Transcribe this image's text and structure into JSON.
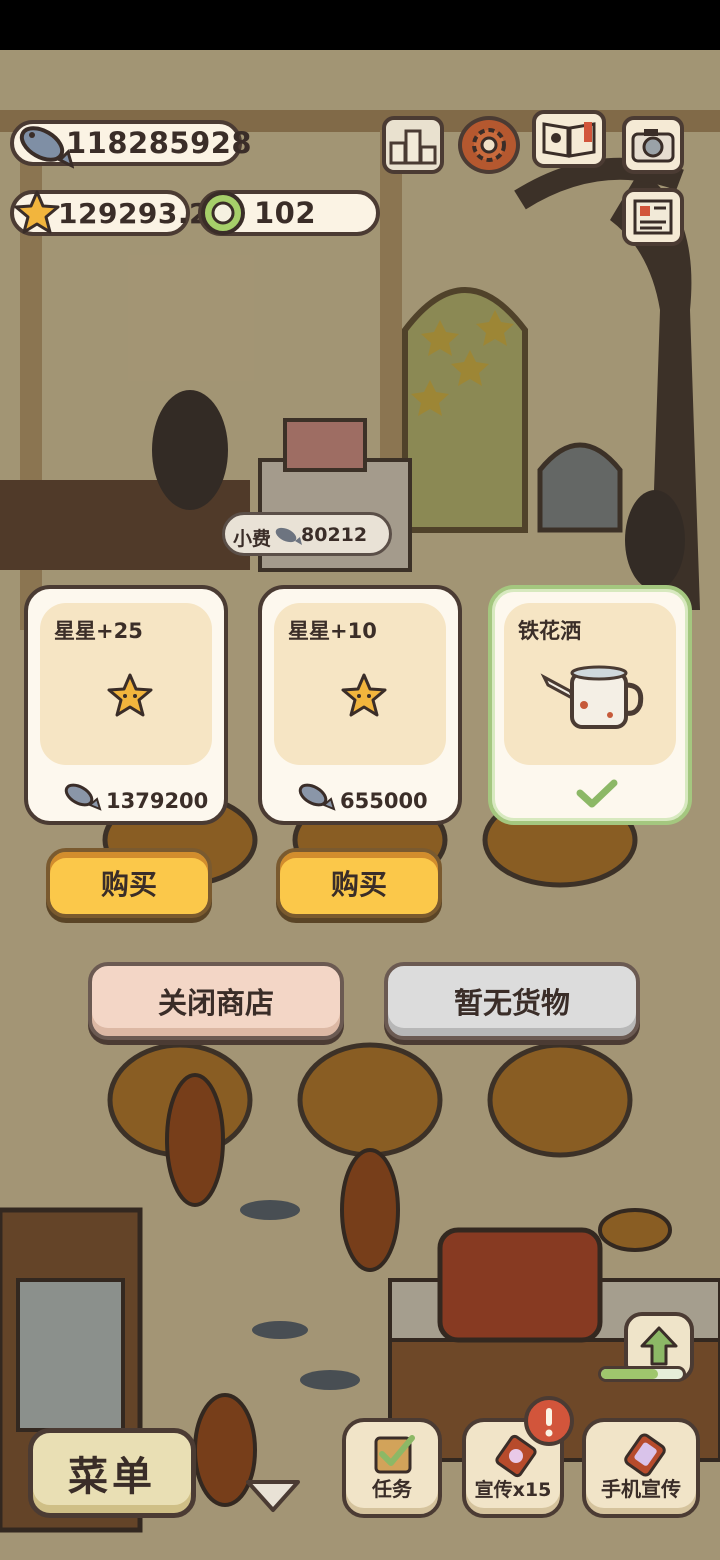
{
  "currency": {
    "fish": "118285928",
    "stars": "129293.2",
    "tokens": "102"
  },
  "tip": {
    "label": "小费",
    "amount": "80212"
  },
  "shop": {
    "items": [
      {
        "title": "星星+25",
        "price": "1379200",
        "buy_label": "购买"
      },
      {
        "title": "星星+10",
        "price": "655000",
        "buy_label": "购买"
      },
      {
        "title": "铁花洒",
        "state": "owned"
      }
    ],
    "close_label": "关闭商店",
    "empty_label": "暂无货物"
  },
  "bottom": {
    "menu_label": "菜单",
    "task_label": "任务",
    "promo_label": "宣传x15",
    "phone_promo_label": "手机宣传"
  },
  "colors": {
    "buy_yellow": "#fbc84a",
    "selected_green": "#a4c77f",
    "card_cream": "#f6e5c4"
  }
}
